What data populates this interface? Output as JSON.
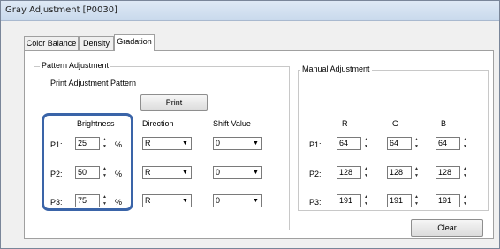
{
  "window": {
    "title": "Gray Adjustment [P0030]"
  },
  "tabs": [
    "Color Balance",
    "Density",
    "Gradation"
  ],
  "pattern": {
    "group_title": "Pattern Adjustment",
    "print_label": "Print Adjustment Pattern",
    "print_button": "Print",
    "headers": {
      "brightness": "Brightness",
      "direction": "Direction",
      "shift": "Shift Value"
    },
    "percent": "%",
    "rows": [
      {
        "label": "P1:",
        "brightness": "25",
        "direction": "R",
        "shift": "0"
      },
      {
        "label": "P2:",
        "brightness": "50",
        "direction": "R",
        "shift": "0"
      },
      {
        "label": "P3:",
        "brightness": "75",
        "direction": "R",
        "shift": "0"
      }
    ]
  },
  "manual": {
    "group_title": "Manual Adjustment",
    "headers": [
      "R",
      "G",
      "B"
    ],
    "rows": [
      {
        "label": "P1:",
        "r": "64",
        "g": "64",
        "b": "64"
      },
      {
        "label": "P2:",
        "r": "128",
        "g": "128",
        "b": "128"
      },
      {
        "label": "P3:",
        "r": "191",
        "g": "191",
        "b": "191"
      }
    ],
    "clear_button": "Clear"
  },
  "colors": {
    "highlight": "#3a64a8",
    "titlebar": "#c9d9ec"
  }
}
